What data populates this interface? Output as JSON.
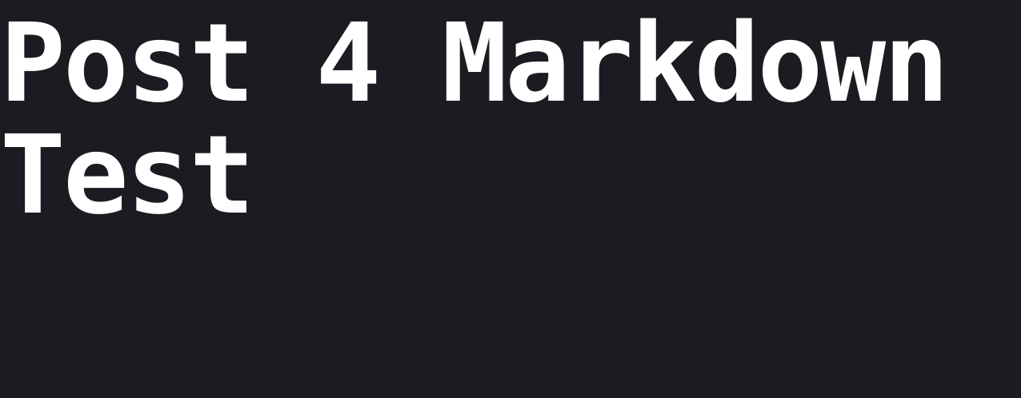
{
  "post": {
    "title_line_1": "Post 4 Markdown",
    "title_line_2": "Test"
  },
  "colors": {
    "background": "#1b1c21",
    "text": "#ffffff"
  }
}
